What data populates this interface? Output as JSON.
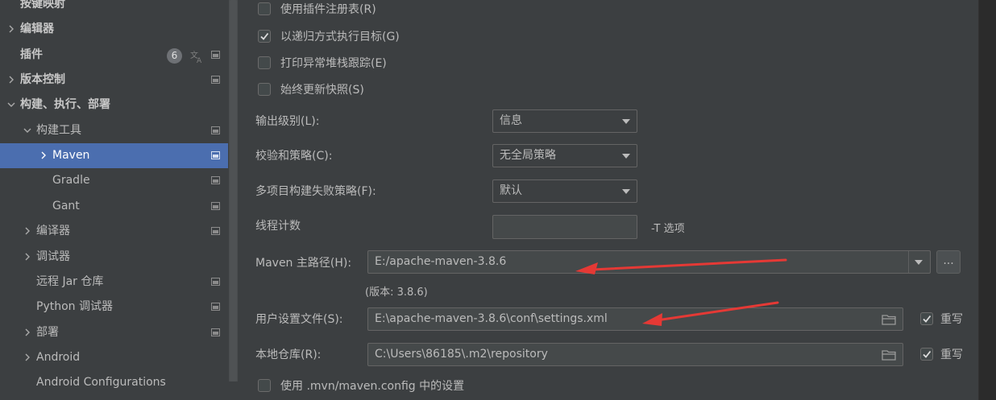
{
  "sidebar": {
    "items": [
      {
        "label": "按键映射",
        "bold": true,
        "chevron": "none",
        "indent": 0,
        "project_icon": false
      },
      {
        "label": "编辑器",
        "bold": true,
        "chevron": "right",
        "indent": 0,
        "project_icon": false
      },
      {
        "label": "插件",
        "bold": true,
        "chevron": "none",
        "indent": 0,
        "project_icon": true,
        "badge": "6",
        "translate_icon": true
      },
      {
        "label": "版本控制",
        "bold": true,
        "chevron": "right",
        "indent": 0,
        "project_icon": true
      },
      {
        "label": "构建、执行、部署",
        "bold": true,
        "chevron": "down",
        "indent": 0,
        "project_icon": false
      },
      {
        "label": "构建工具",
        "bold": false,
        "chevron": "down",
        "indent": 1,
        "project_icon": true
      },
      {
        "label": "Maven",
        "bold": false,
        "chevron": "right",
        "indent": 2,
        "project_icon": true,
        "selected": true
      },
      {
        "label": "Gradle",
        "bold": false,
        "chevron": "none",
        "indent": 2,
        "project_icon": true
      },
      {
        "label": "Gant",
        "bold": false,
        "chevron": "none",
        "indent": 2,
        "project_icon": true
      },
      {
        "label": "编译器",
        "bold": false,
        "chevron": "right",
        "indent": 1,
        "project_icon": true
      },
      {
        "label": "调试器",
        "bold": false,
        "chevron": "right",
        "indent": 1,
        "project_icon": false
      },
      {
        "label": "远程 Jar 仓库",
        "bold": false,
        "chevron": "none",
        "indent": 1,
        "project_icon": true
      },
      {
        "label": "Python 调试器",
        "bold": false,
        "chevron": "none",
        "indent": 1,
        "project_icon": true
      },
      {
        "label": "部署",
        "bold": false,
        "chevron": "right",
        "indent": 1,
        "project_icon": true
      },
      {
        "label": "Android",
        "bold": false,
        "chevron": "right",
        "indent": 1,
        "project_icon": false
      },
      {
        "label": "Android Configurations",
        "bold": false,
        "chevron": "none",
        "indent": 1,
        "project_icon": false
      }
    ]
  },
  "checkboxes": [
    {
      "label": "使用插件注册表(R)",
      "checked": false
    },
    {
      "label": "以递归方式执行目标(G)",
      "checked": true
    },
    {
      "label": "打印异常堆栈跟踪(E)",
      "checked": false
    },
    {
      "label": "始终更新快照(S)",
      "checked": false
    }
  ],
  "output_level": {
    "label": "输出级别(L):",
    "value": "信息"
  },
  "checksum_policy": {
    "label": "校验和策略(C):",
    "value": "无全局策略"
  },
  "multiproject_fail_policy": {
    "label": "多项目构建失败策略(F):",
    "value": "默认"
  },
  "thread_count": {
    "label": "线程计数",
    "value": "",
    "hint": "-T 选项"
  },
  "maven_home": {
    "label": "Maven 主路径(H):",
    "value": "E:/apache-maven-3.8.6",
    "version": "(版本: 3.8.6)",
    "browse_label": "..."
  },
  "user_settings": {
    "label": "用户设置文件(S):",
    "value": "E:\\apache-maven-3.8.6\\conf\\settings.xml",
    "override_label": "重写",
    "override_checked": true
  },
  "local_repo": {
    "label": "本地仓库(R):",
    "value": "C:\\Users\\86185\\.m2\\repository",
    "override_label": "重写",
    "override_checked": true
  },
  "mvn_config": {
    "label": "使用 .mvn/maven.config 中的设置",
    "checked": false
  },
  "colors": {
    "selection": "#4b6eaf",
    "annotation_arrow": "#e53935",
    "background": "#3c3f41"
  }
}
